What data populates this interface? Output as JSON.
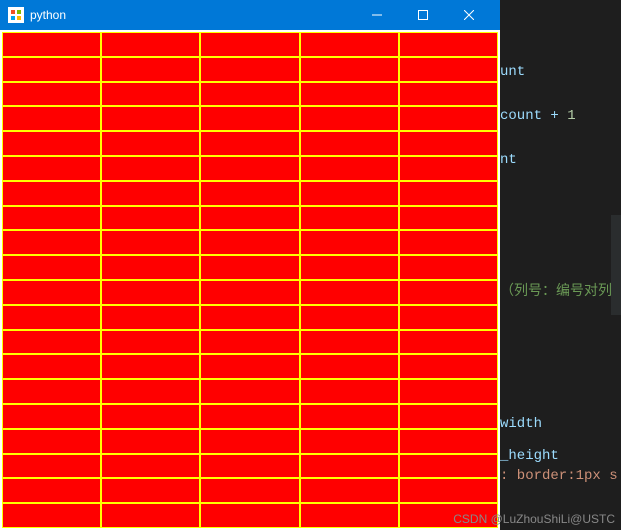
{
  "window": {
    "title": "python",
    "grid": {
      "rows": 20,
      "cols": 5
    }
  },
  "code": {
    "t1": "unt",
    "t2": "count + ",
    "t2n": "1",
    "t3": "nt",
    "c1": "（列号：编号对列数取",
    "t4": "width",
    "t5": "_height",
    "t6": ": border:1px s"
  },
  "watermark": "CSDN @LuZhouShiLi@USTC"
}
